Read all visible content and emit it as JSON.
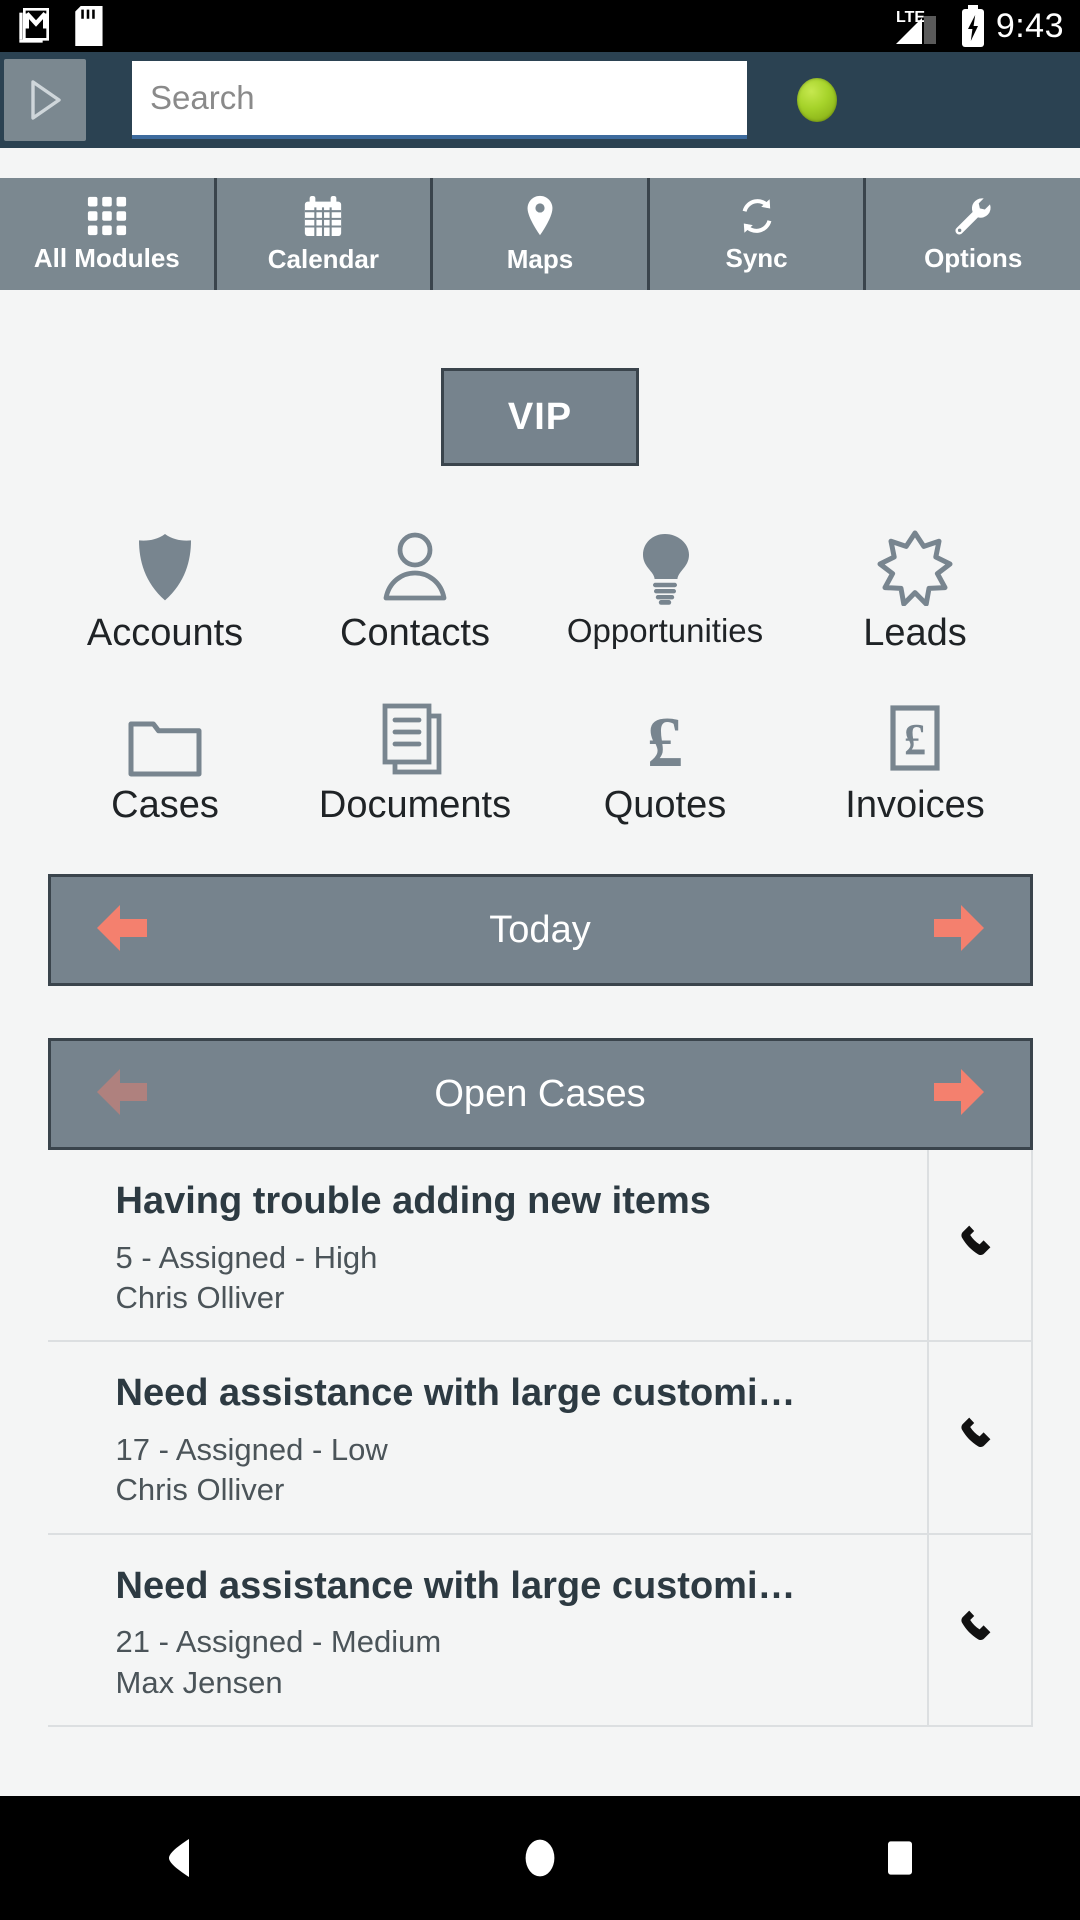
{
  "status_bar": {
    "time": "9:43",
    "icons": [
      "gmail-icon",
      "sd-card-icon",
      "lte-signal-icon",
      "battery-charging-icon"
    ],
    "network_label": "LTE"
  },
  "app_header": {
    "menu_icon": "play-triangle-icon",
    "search": {
      "value": "",
      "placeholder": "Search"
    },
    "sync_status_indicator": "green-status-dot",
    "colors": {
      "background": "#2b4252",
      "indicator": "#a6d32a"
    }
  },
  "nav_tabs": [
    {
      "label": "All Modules",
      "icon": "grid-icon"
    },
    {
      "label": "Calendar",
      "icon": "calendar-icon"
    },
    {
      "label": "Maps",
      "icon": "map-pin-icon"
    },
    {
      "label": "Sync",
      "icon": "sync-refresh-icon"
    },
    {
      "label": "Options",
      "icon": "wrench-icon"
    }
  ],
  "vip_button": {
    "label": "VIP"
  },
  "modules": [
    {
      "label": "Accounts",
      "icon": "shield-icon"
    },
    {
      "label": "Contacts",
      "icon": "person-icon"
    },
    {
      "label": "Opportunities",
      "icon": "lightbulb-icon"
    },
    {
      "label": "Leads",
      "icon": "star-burst-icon"
    },
    {
      "label": "Cases",
      "icon": "folder-icon"
    },
    {
      "label": "Documents",
      "icon": "documents-icon"
    },
    {
      "label": "Quotes",
      "icon": "pound-sign-icon"
    },
    {
      "label": "Invoices",
      "icon": "pound-invoice-icon"
    }
  ],
  "today_bar": {
    "title": "Today",
    "prev_arrow": "arrow-left-icon",
    "next_arrow": "arrow-right-icon",
    "prev_enabled": true
  },
  "open_cases_bar": {
    "title": "Open Cases",
    "prev_arrow": "arrow-left-icon",
    "next_arrow": "arrow-right-icon",
    "prev_enabled": false
  },
  "cases": [
    {
      "title": "Having trouble adding new items",
      "meta": "5 - Assigned - High",
      "contact": "Chris Olliver",
      "call_icon": "phone-icon"
    },
    {
      "title": "Need assistance with large customiza…",
      "meta": "17 - Assigned - Low",
      "contact": "Chris Olliver",
      "call_icon": "phone-icon"
    },
    {
      "title": "Need assistance with large customiza…",
      "meta": "21 - Assigned - Medium",
      "contact": "Max Jensen",
      "call_icon": "phone-icon"
    }
  ],
  "android_nav": [
    {
      "label": "Back",
      "icon": "back-triangle-icon"
    },
    {
      "label": "Home",
      "icon": "home-circle-icon"
    },
    {
      "label": "Recents",
      "icon": "recents-square-icon"
    }
  ],
  "theme": {
    "header_bg": "#2b4252",
    "tab_bg": "#7b8890",
    "panel_bg": "#76838d",
    "panel_border": "#3a444c",
    "accent_arrow": "#f4806e",
    "page_bg": "#f4f5f5",
    "icon_gray": "#78858f",
    "title_text": "#2d3a42"
  }
}
